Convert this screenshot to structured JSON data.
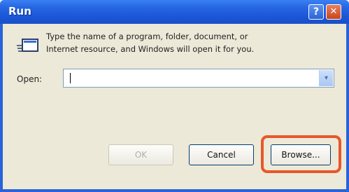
{
  "window": {
    "title": "Run",
    "help_label": "?",
    "close_label": "✕"
  },
  "dialog": {
    "description_line1": "Type the name of a program, folder, document, or",
    "description_line2": "Internet resource, and Windows will open it for you.",
    "open_label": "Open:",
    "open_value": "",
    "dropdown_glyph": "▾"
  },
  "buttons": {
    "ok": "OK",
    "cancel": "Cancel",
    "browse": "Browse..."
  },
  "colors": {
    "titlebar": "#2a63d8",
    "highlight": "#e8572b",
    "dialog_bg": "#ece9d8"
  },
  "icons": {
    "run": "run-program-icon",
    "help": "help-icon",
    "close": "close-icon",
    "dropdown": "chevron-down-icon"
  }
}
